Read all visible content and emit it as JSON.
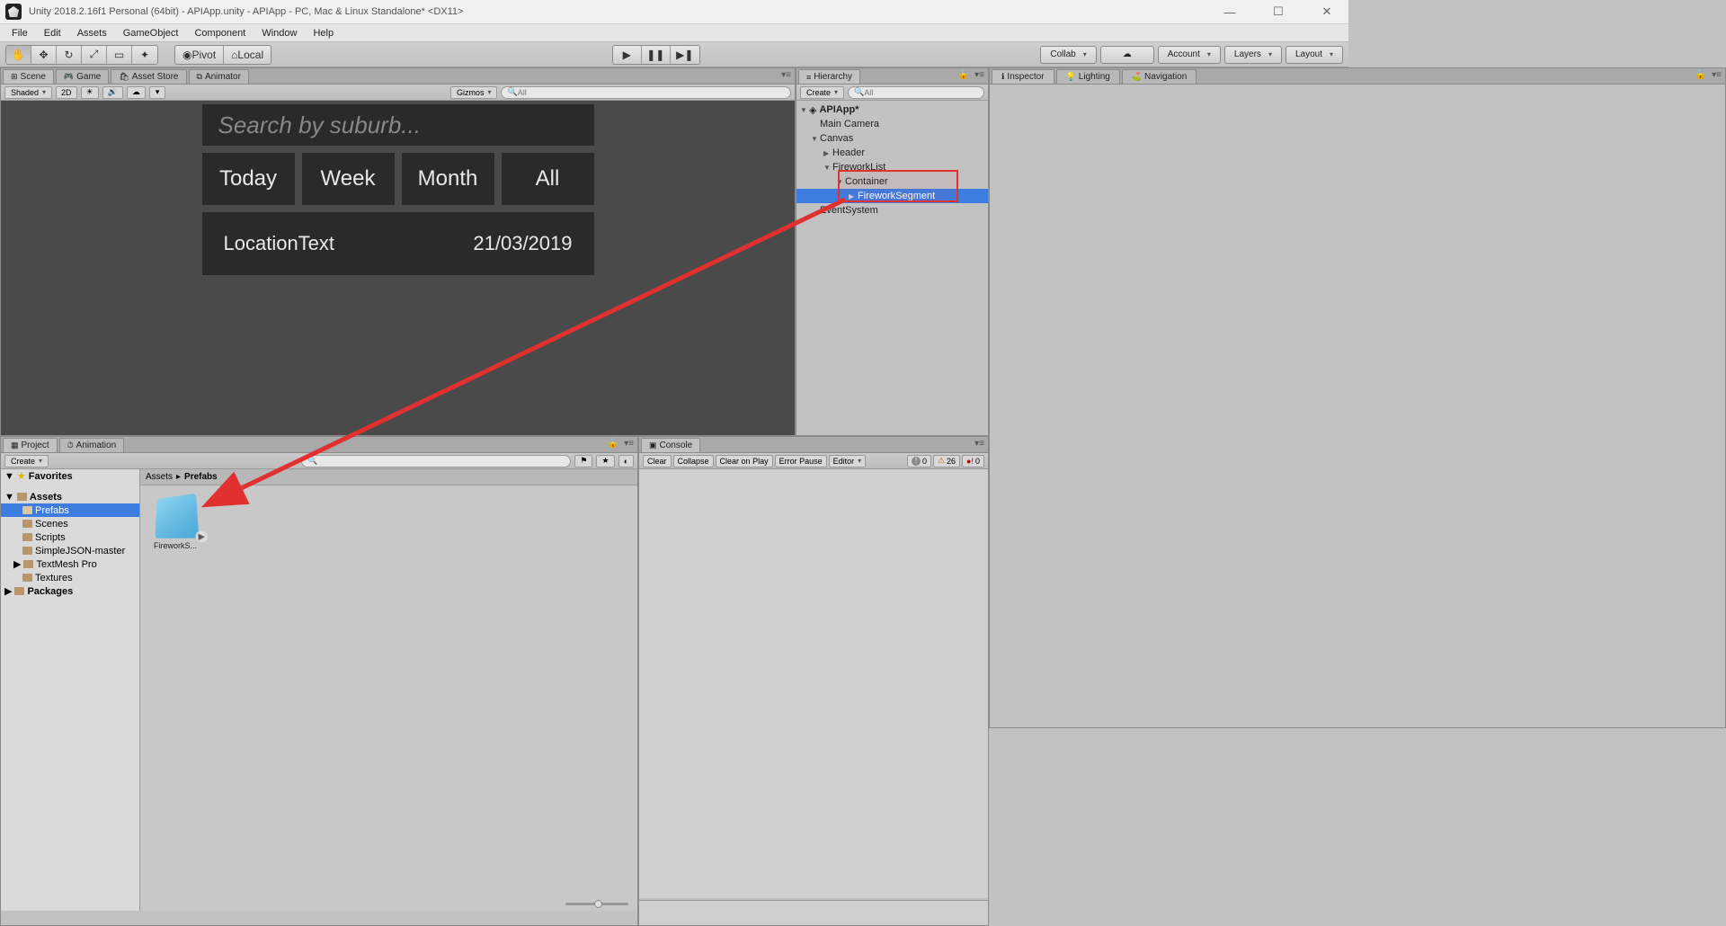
{
  "window": {
    "title": "Unity 2018.2.16f1 Personal (64bit) - APIApp.unity - APIApp - PC, Mac & Linux Standalone* <DX11>",
    "min": "—",
    "max": "☐",
    "close": "✕"
  },
  "menu": [
    "File",
    "Edit",
    "Assets",
    "GameObject",
    "Component",
    "Window",
    "Help"
  ],
  "toolbar": {
    "pivot": "Pivot",
    "local": "Local",
    "collab": "Collab",
    "account": "Account",
    "layers": "Layers",
    "layout": "Layout"
  },
  "scene": {
    "tabs": [
      "Scene",
      "Game",
      "Asset Store",
      "Animator"
    ],
    "shading": "Shaded",
    "mode2d": "2D",
    "gizmos": "Gizmos",
    "search_hint": "All",
    "app": {
      "search_placeholder": "Search by suburb...",
      "tabs": [
        "Today",
        "Week",
        "Month",
        "All"
      ],
      "location_label": "LocationText",
      "date": "21/03/2019"
    }
  },
  "hierarchy": {
    "title": "Hierarchy",
    "create": "Create",
    "search_hint": "All",
    "root": "APIApp*",
    "items": {
      "main_camera": "Main Camera",
      "canvas": "Canvas",
      "header": "Header",
      "firework_list": "FireworkList",
      "container": "Container",
      "firework_segment": "FireworkSegment",
      "event_system": "EventSystem"
    }
  },
  "inspector": {
    "tabs": [
      "Inspector",
      "Lighting",
      "Navigation"
    ]
  },
  "project": {
    "tabs": [
      "Project",
      "Animation"
    ],
    "create": "Create",
    "favorites": "Favorites",
    "assets_root": "Assets",
    "folders": [
      "Prefabs",
      "Scenes",
      "Scripts",
      "SimpleJSON-master",
      "TextMesh Pro",
      "Textures"
    ],
    "packages": "Packages",
    "breadcrumb": [
      "Assets",
      "Prefabs"
    ],
    "asset_name": "FireworkS..."
  },
  "console": {
    "title": "Console",
    "buttons": {
      "clear": "Clear",
      "collapse": "Collapse",
      "clear_on_play": "Clear on Play",
      "error_pause": "Error Pause",
      "editor": "Editor"
    },
    "counts": {
      "info": "0",
      "warn": "26",
      "err": "0"
    }
  }
}
